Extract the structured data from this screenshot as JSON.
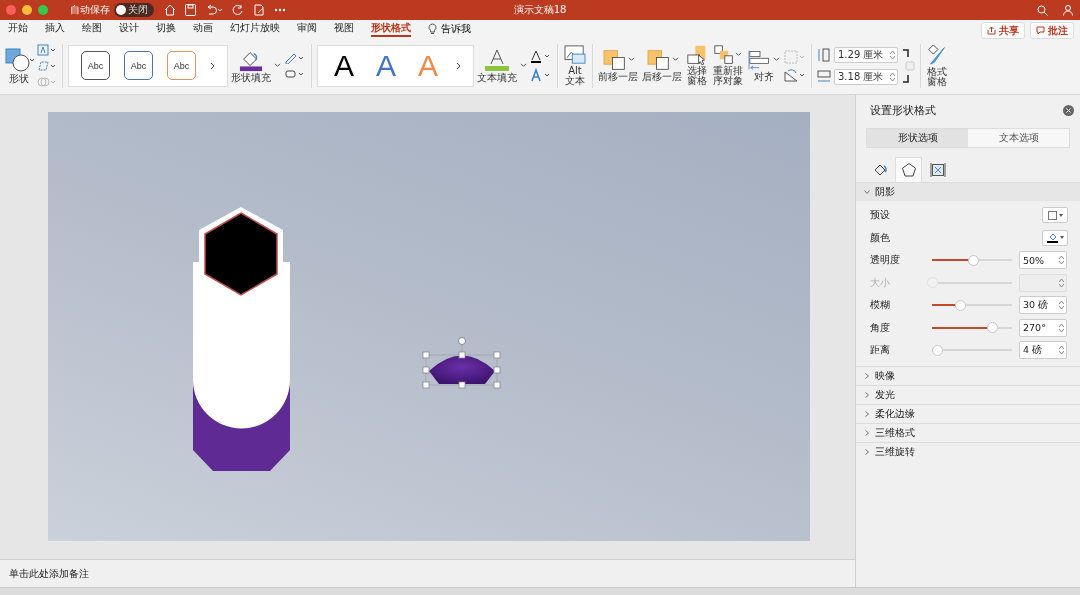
{
  "title_bar": {
    "autosave_label": "自动保存",
    "autosave_toggle": {
      "label": "关闭",
      "on": false
    },
    "document_title": "演示文稿18"
  },
  "tabs": [
    {
      "label": "开始",
      "selected": false
    },
    {
      "label": "插入",
      "selected": false
    },
    {
      "label": "绘图",
      "selected": false
    },
    {
      "label": "设计",
      "selected": false
    },
    {
      "label": "切换",
      "selected": false
    },
    {
      "label": "动画",
      "selected": false
    },
    {
      "label": "幻灯片放映",
      "selected": false
    },
    {
      "label": "审阅",
      "selected": false
    },
    {
      "label": "视图",
      "selected": false
    },
    {
      "label": "形状格式",
      "selected": true
    }
  ],
  "tell_me": "告诉我",
  "share_button": "共享",
  "comments_button": "批注",
  "ribbon": {
    "shape_label": "形状",
    "shape_styles": [
      {
        "label": "Abc",
        "color": "#555555"
      },
      {
        "label": "Abc",
        "color": "#4a74b5"
      },
      {
        "label": "Abc",
        "color": "#e0945a"
      }
    ],
    "shape_fill_label": "形状填充",
    "wordart_styles": [
      {
        "label": "A",
        "color": "#000000"
      },
      {
        "label": "A",
        "color": "#4472c4"
      },
      {
        "label": "A",
        "color": "#ed8a46"
      }
    ],
    "text_fill_label": "文本填充",
    "alt_text_label": "Alt\n文本",
    "arrange_buttons": [
      {
        "kind": "forward",
        "label": "前移一层"
      },
      {
        "kind": "backward",
        "label": "后移一层"
      },
      {
        "kind": "pane",
        "label": "选择窗格"
      },
      {
        "kind": "reorder",
        "label": "重新排序对象"
      },
      {
        "kind": "align",
        "label": "对齐"
      }
    ],
    "height_value": "1.29 厘米",
    "width_value": "3.18 厘米",
    "format_pane_label": "格式窗格"
  },
  "notes_placeholder": "单击此处添加备注",
  "pane": {
    "title": "设置形状格式",
    "tabs": [
      {
        "label": "形状选项",
        "selected": true
      },
      {
        "label": "文本选项",
        "selected": false
      }
    ],
    "icon_tabs": [
      {
        "kind": "fill",
        "selected": false
      },
      {
        "kind": "shape",
        "selected": true
      },
      {
        "kind": "size",
        "selected": false
      }
    ],
    "sections": [
      {
        "label": "阴影",
        "expanded": true,
        "rows": [
          {
            "kind": "preset",
            "label": "预设"
          },
          {
            "kind": "color",
            "label": "颜色"
          },
          {
            "kind": "slider",
            "label": "透明度",
            "level": 0.52,
            "value": "50%",
            "disabled": false
          },
          {
            "kind": "slider",
            "label": "大小",
            "level": 0,
            "disabled": true
          },
          {
            "kind": "slider",
            "label": "模糊",
            "level": 0.35,
            "value": "30 磅",
            "disabled": false
          },
          {
            "kind": "slider",
            "label": "角度",
            "level": 0.75,
            "value": "270°",
            "disabled": false
          },
          {
            "kind": "slider",
            "label": "距离",
            "level": 0.07,
            "value": "4 磅",
            "disabled": false
          }
        ]
      },
      {
        "label": "映像",
        "expanded": false
      },
      {
        "label": "发光",
        "expanded": false
      },
      {
        "label": "柔化边缘",
        "expanded": false
      },
      {
        "label": "三维格式",
        "expanded": false
      },
      {
        "label": "三维旋转",
        "expanded": false
      }
    ]
  }
}
